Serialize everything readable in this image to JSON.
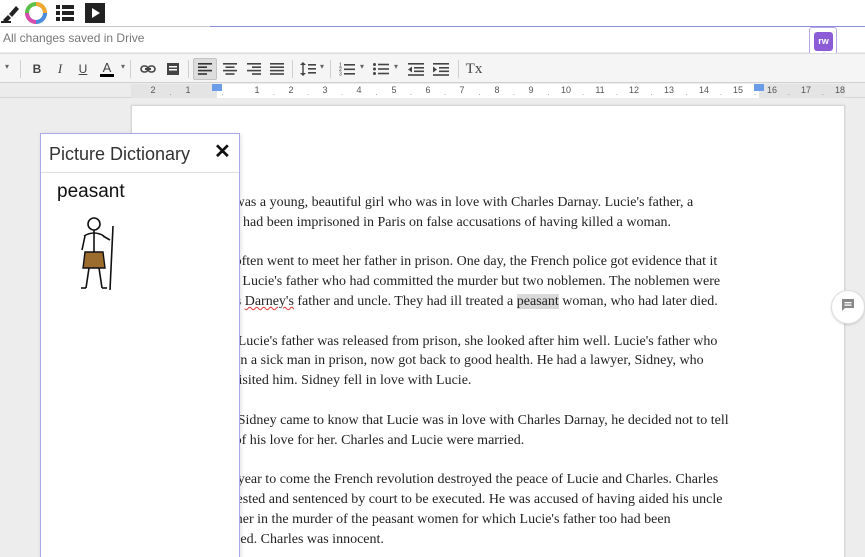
{
  "toolbar_plugin": {
    "icons": [
      "highlighter-icon",
      "color-wheel-icon",
      "list-icon",
      "play-icon"
    ]
  },
  "status": {
    "saved_text": "All changes saved in Drive"
  },
  "rw_badge": {
    "label": "rw",
    "accent": "#8b5cd6"
  },
  "format_toolbar": {
    "bold_label": "B",
    "italic_label": "I",
    "underline_label": "U",
    "text_color_label": "A",
    "text_color": "#000000",
    "clear_format_label": "Tx"
  },
  "ruler": {
    "numbers": [
      "2",
      "1",
      "1",
      "2",
      "3",
      "4",
      "5",
      "6",
      "7",
      "8",
      "9",
      "10",
      "11",
      "12",
      "13",
      "14",
      "15",
      "16",
      "17",
      "18"
    ]
  },
  "document": {
    "paragraphs": [
      [
        "ie was a young, beautiful girl who was in love with Charles Darnay. Lucie's father, a",
        "tor, had been imprisoned in Paris on false accusations of having killed a woman."
      ],
      [
        "ie often went to meet her father in prison. One day, the French police got evidence that it",
        "not Lucie's father who had committed the murder but two noblemen. The noblemen were"
      ],
      [
        "en Lucie's father was released from prison, she looked after him well. Lucie's father who",
        "been a sick man in prison, now got back to good health. He had a lawyer, Sidney, who",
        "n visited him. Sidney fell in love with Lucie."
      ],
      [
        "en Sidney came to know that Lucie was in love with Charles Darnay, he decided not to tell",
        "ie of his love for her. Charles and Lucie were married."
      ],
      [
        "he year to come the French revolution destroyed the peace of Lucie and Charles. Charles",
        "arrested and sentenced by court to be executed. He was accused of having aided his uncle",
        "father in the murder of the peasant women for which Lucie's father too had been",
        "enced. Charles was innocent."
      ]
    ],
    "p2_line3_a": "rles ",
    "p2_line3_misspelled": "Darney's",
    "p2_line3_b": " father and uncle. They had ill treated a ",
    "p2_line3_highlight": "peasant",
    "p2_line3_c": " woman, who had later died."
  },
  "dictionary": {
    "title": "Picture Dictionary",
    "close_label": "✕",
    "word": "peasant",
    "image": "peasant-figure-icon"
  }
}
